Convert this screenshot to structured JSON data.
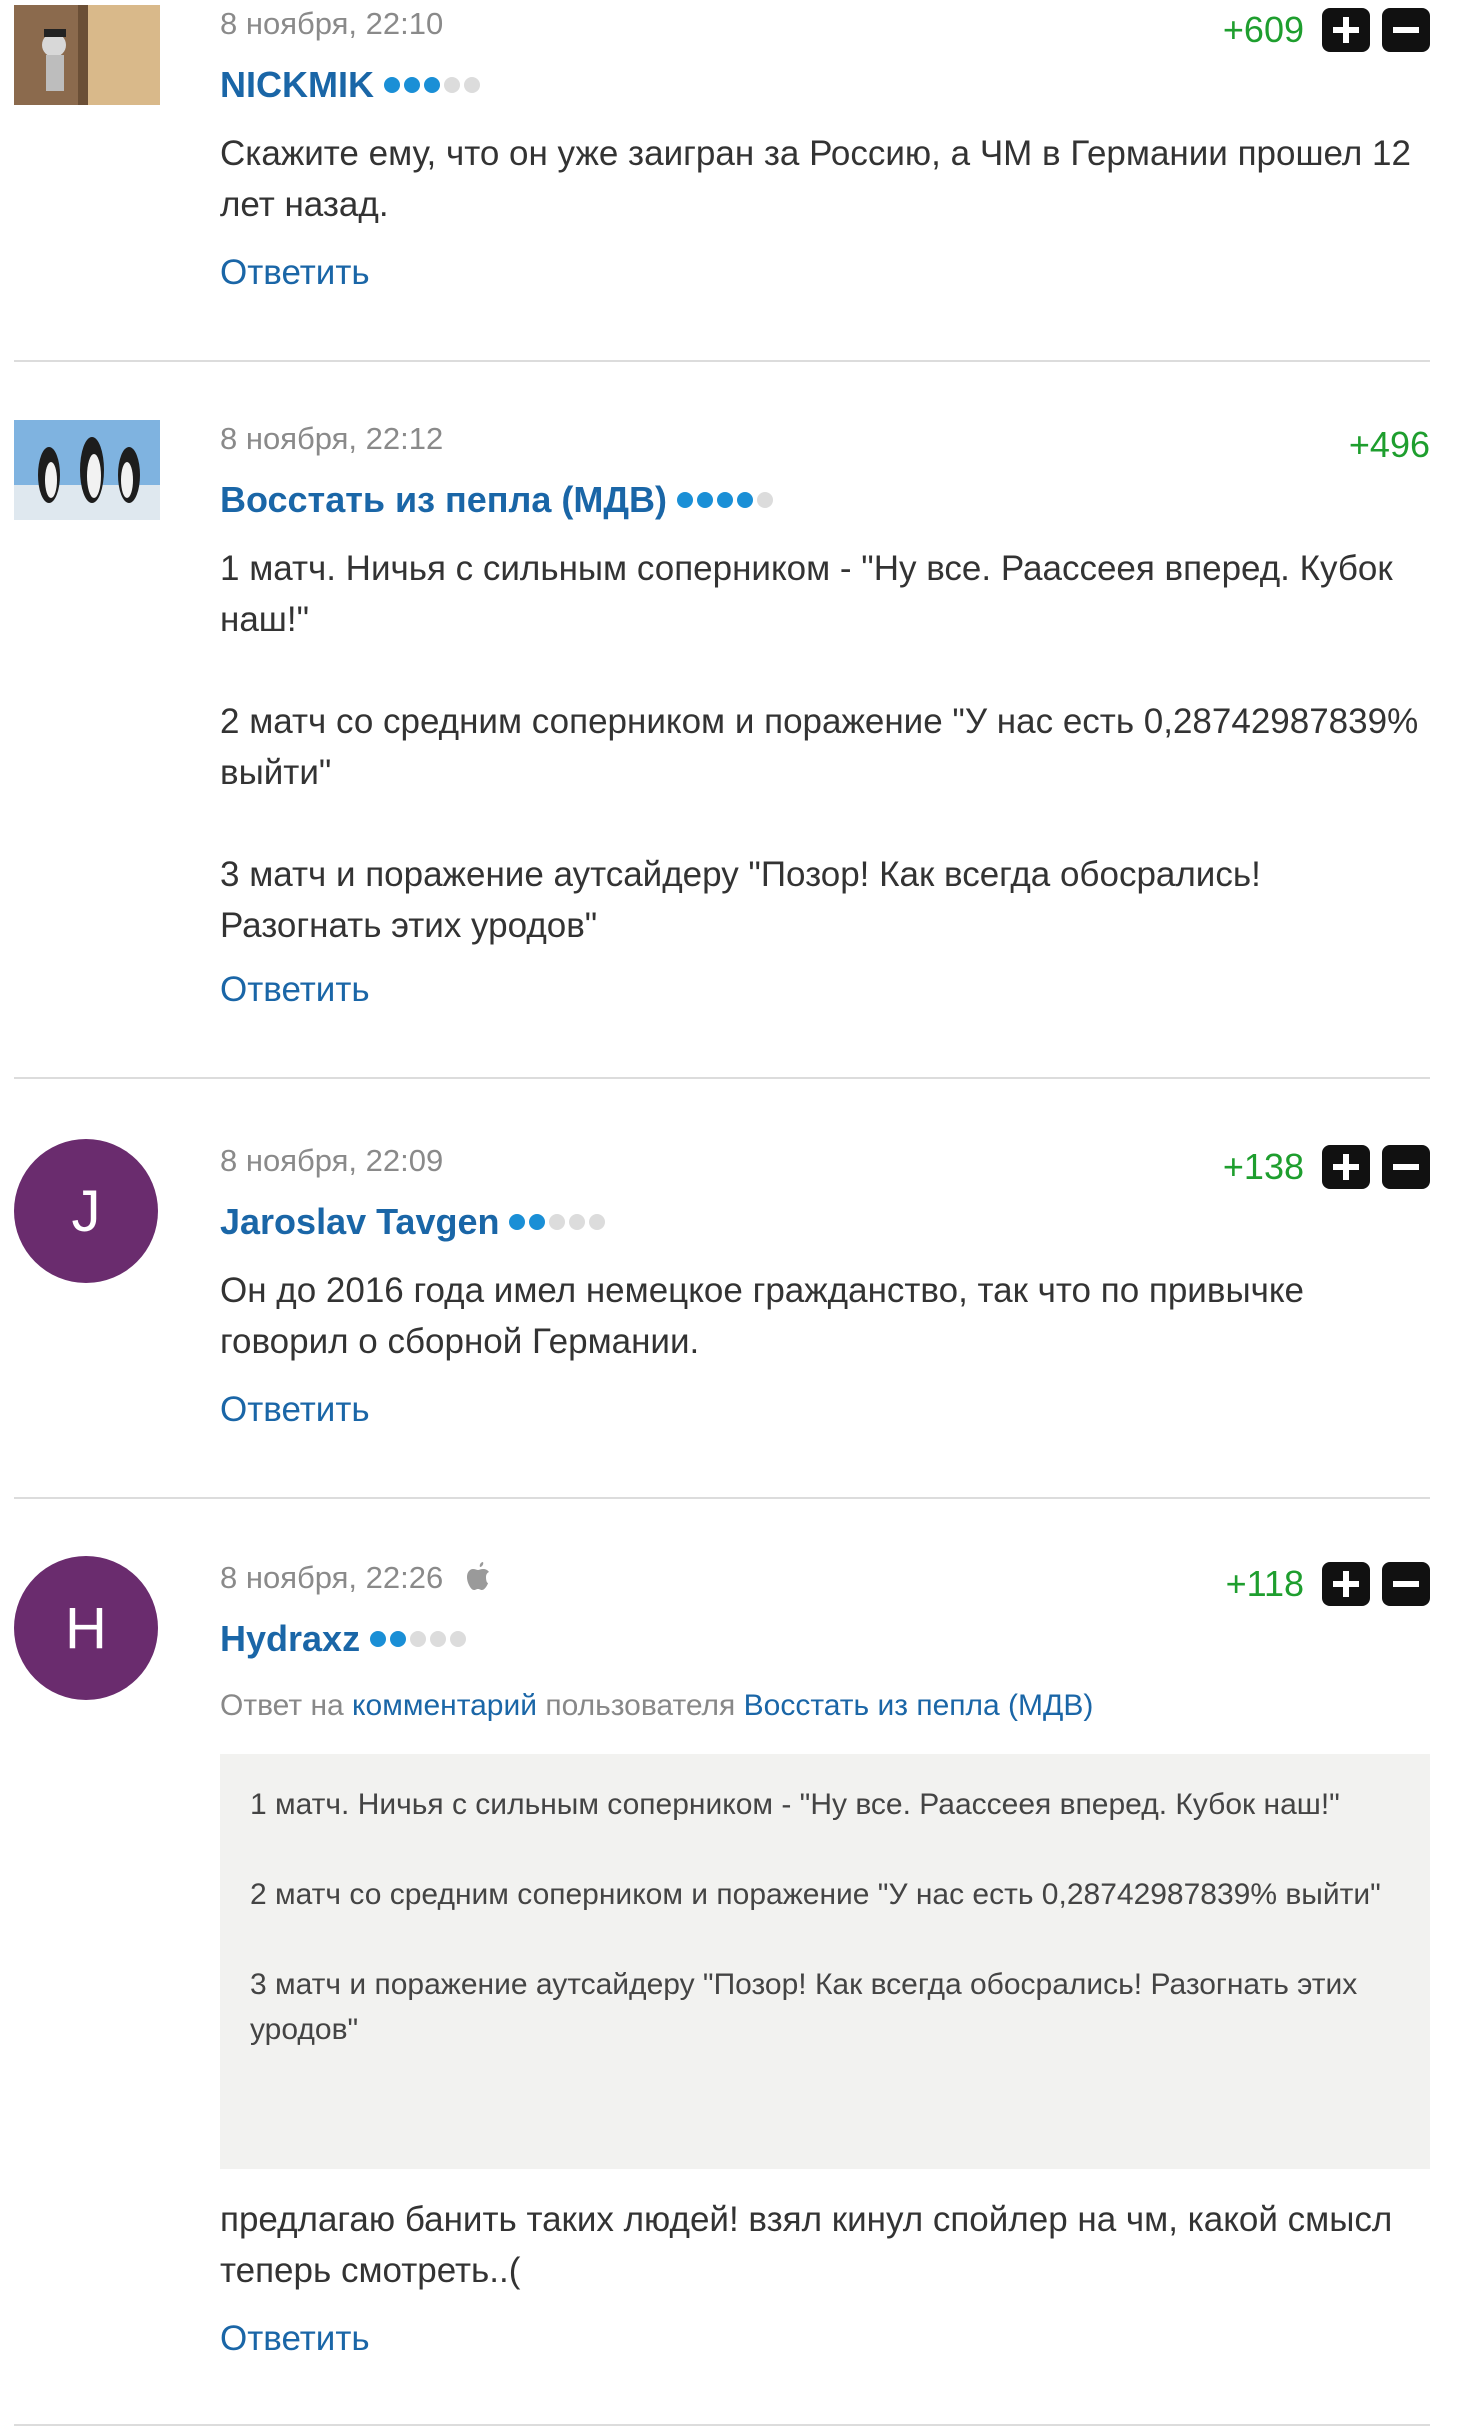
{
  "reply_label": "Ответить",
  "comments": [
    {
      "date": "8 ноября, 22:10",
      "score": "+609",
      "author": "NICKMIK",
      "rank_level": 3,
      "paragraphs": [
        "Скажите ему, что он уже заигран за Россию, а ЧМ в Германии прошел 12 лет назад."
      ]
    },
    {
      "date": "8 ноября, 22:12",
      "score": "+496",
      "author": "Восстать из пепла (МДВ)",
      "rank_level": 4,
      "paragraphs": [
        "1 матч. Ничья с сильным соперником - \"Ну все. Раассеея вперед. Кубок наш!\"",
        "2 матч со средним соперником и поражение \"У нас есть 0,28742987839% выйти\"",
        "3 матч и поражение аутсайдеру \"Позор! Как всегда обосрались! Разогнать этих уродов\""
      ]
    },
    {
      "date": "8 ноября, 22:09",
      "score": "+138",
      "author": "Jaroslav Tavgen",
      "avatar_letter": "J",
      "rank_level": 2,
      "paragraphs": [
        "Он до 2016 года имел немецкое гражданство, так что по привычке говорил о сборной Германии."
      ]
    },
    {
      "date": "8 ноября, 22:26",
      "score": "+118",
      "author": "Hydraxz",
      "avatar_letter": "H",
      "rank_level": 2,
      "reply_to": {
        "prefix": "Ответ на",
        "link_comment": "комментарий",
        "middle": "пользователя",
        "link_user": "Восстать из пепла (МДВ)"
      },
      "quote": [
        "1 матч. Ничья с сильным соперником - \"Ну все. Раассеея вперед. Кубок наш!\"",
        "2 матч со средним соперником и поражение \"У нас есть 0,28742987839% выйти\"",
        "3 матч и поражение аутсайдеру \"Позор! Как всегда обосрались! Разогнать этих уродов\""
      ],
      "paragraphs": [
        "предлагаю банить таких людей! взял кинул спойлер на чм, какой смысл теперь смотреть..("
      ]
    }
  ]
}
